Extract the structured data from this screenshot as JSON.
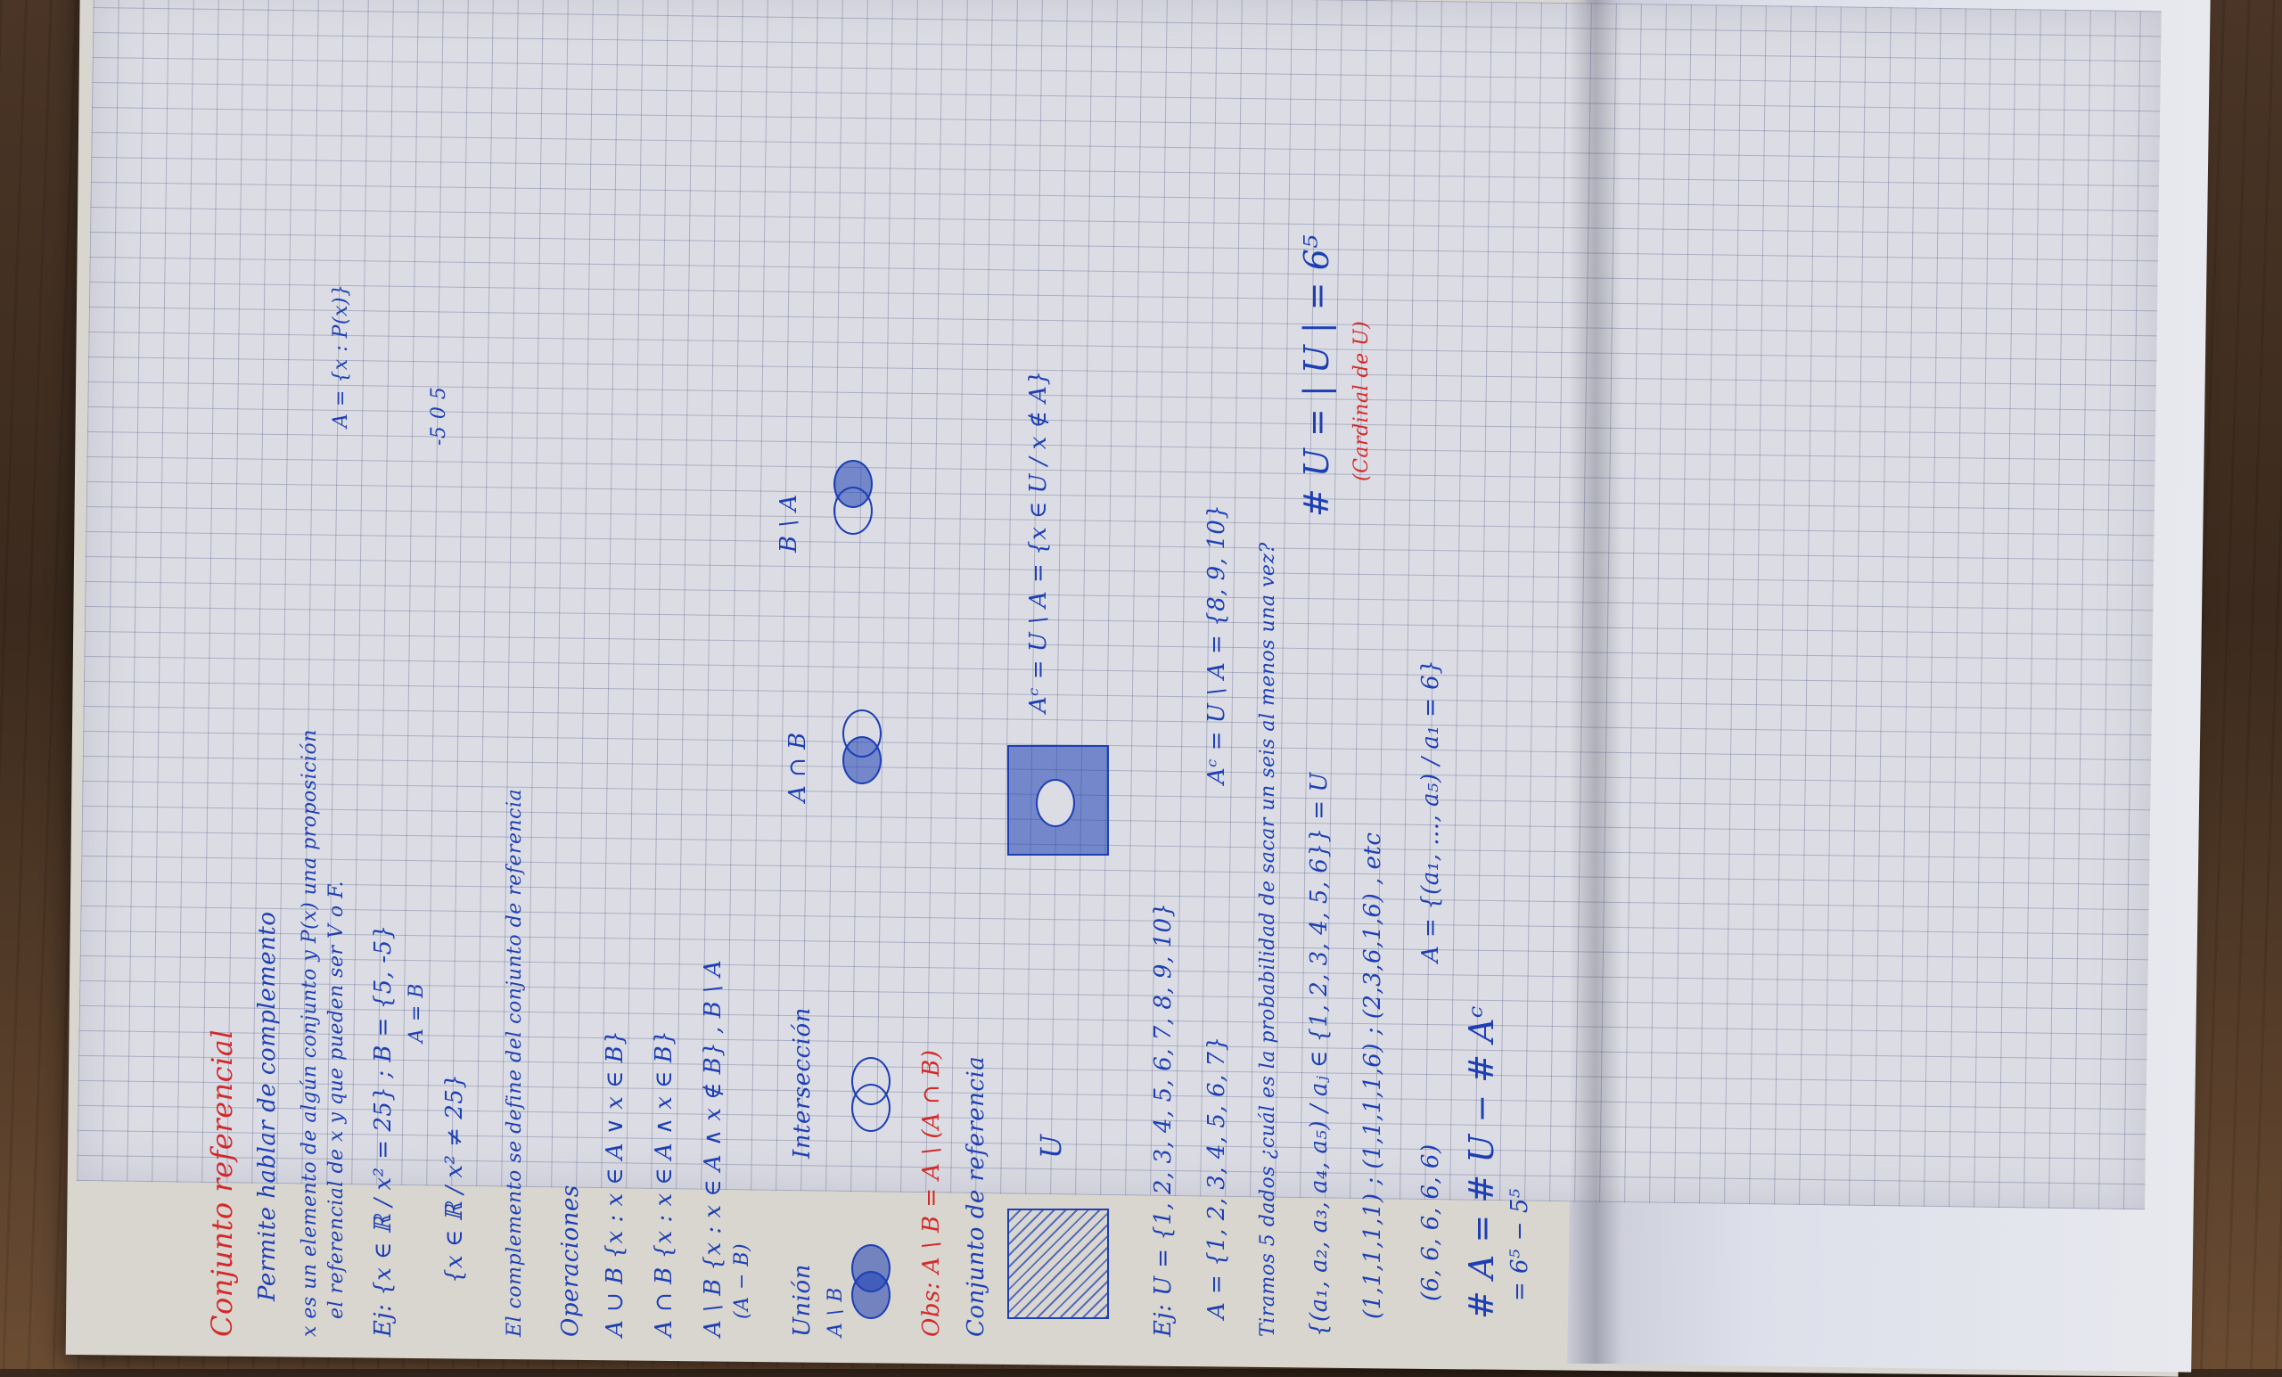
{
  "lines": {
    "title": "Conjunto referencial",
    "subtitle": "Permite hablar de complemento",
    "intro1": "x es un elemento de algún conjunto y P(x) una proposición",
    "intro2": "el referencial de x y que pueden ser V o F.",
    "def_set": "A = {x : P(x)}",
    "example1": "Ej: {x ∈ ℝ / x² = 25} ; B = {5, -5}",
    "example1b": "A = B",
    "example2": "{x ∈ ℝ / x² ≠ 25}",
    "complement_def": "El complemento se define del conjunto de referencia",
    "operations": "Operaciones",
    "union_def": "A ∪ B   {x : x ∈ A ∨ x ∈ B}",
    "inter_def": "A ∩ B   {x : x ∈ A ∧ x ∈ B}",
    "diff_def": "A \\ B   {x : x ∈ A ∧ x ∉ B} , B \\ A",
    "diff_note": "(A − B)",
    "union": "Unión",
    "intersection": "Intersección",
    "a_inter_b": "A ∩ B",
    "b_minus_a": "B \\ A",
    "a_minus_b_label": "A \\ B",
    "obs": "Obs: A \\ B = A \\ (A ∩ B)",
    "ref_set": "Conjunto de referencia",
    "u_label": "U",
    "complement_formula": "Aᶜ = U \\ A = {x ∈ U / x ∉ A}",
    "ej_u": "Ej: U = {1, 2, 3, 4, 5, 6, 7, 8, 9, 10}",
    "ej_a": "A = {1, 2, 3, 4, 5, 6, 7}",
    "ej_ac": "Aᶜ = U \\ A = {8, 9, 10}",
    "dice": "Tiramos 5 dados ¿cuál es la probabilidad de sacar un seis al menos una vez?",
    "tuples": "{(a₁, a₂, a₃, a₄, a₅) / aⱼ ∈ {1, 2, 3, 4, 5, 6}} = U",
    "hash_u": "# U = | U | = 6⁵",
    "cardinal_note": "(Cardinal de U)",
    "examples": "(1,1,1,1,1) ; (1,1,1,1,6) ; (2,3,6,1,6) , etc",
    "six": "(6, 6, 6, 6, 6)",
    "a_def": "A = {(a₁, ..., a₅) / a₁ = 6}",
    "hash_a": "# A = # U − # Aᶜ",
    "hash_a2": "= 6⁵ − 5⁵",
    "number_line": "-5   0   5"
  },
  "colors": {
    "ink_blue": "#1d3fb5",
    "ink_red": "#d22a2a",
    "paper": "#dcdde4",
    "grid": "#5a648c"
  }
}
